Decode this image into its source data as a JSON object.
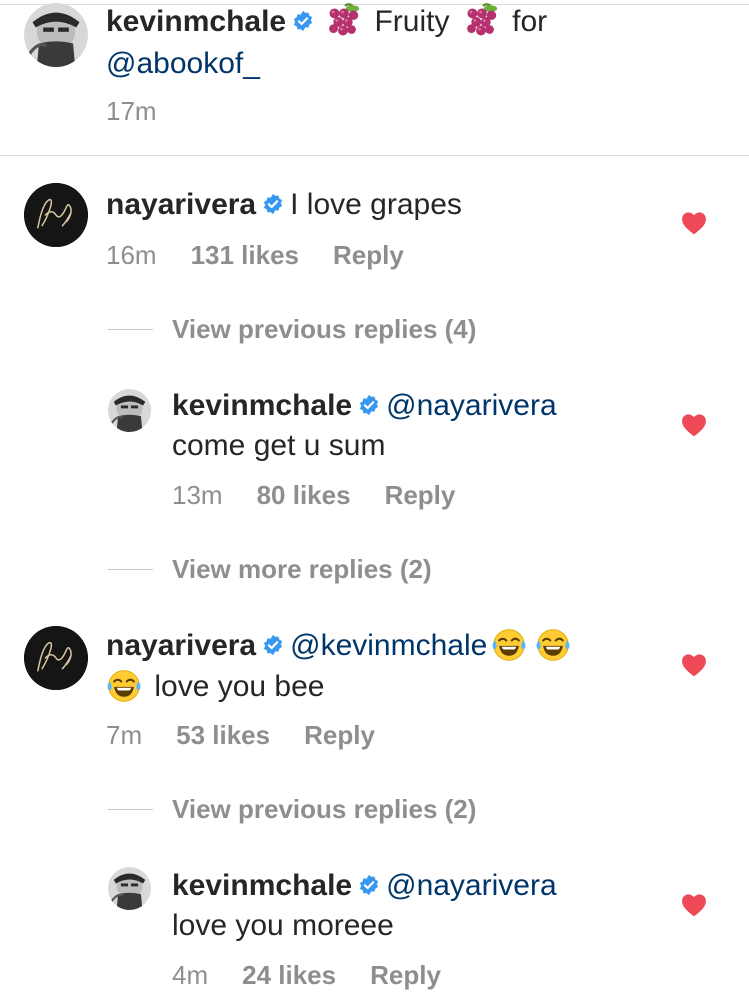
{
  "caption": {
    "username": "kevinmchale",
    "text_1": "Fruity",
    "text_2": "for",
    "mention": "@abookof_",
    "time": "17m",
    "emoji": "grapes-emoji"
  },
  "comments": [
    {
      "username": "nayarivera",
      "text": "I love grapes",
      "time": "16m",
      "likes": "131 likes",
      "reply": "Reply",
      "liked": true
    },
    {
      "view_replies": "View previous replies (4)"
    },
    {
      "username": "kevinmchale",
      "mention": "@nayarivera",
      "text": "come get u sum",
      "time": "13m",
      "likes": "80 likes",
      "reply": "Reply",
      "liked": true
    },
    {
      "view_replies": "View more replies (2)"
    },
    {
      "username": "nayarivera",
      "mention": "@kevinmchale",
      "text": "love you bee",
      "emoji": "face-with-tears-of-joy-emoji",
      "time": "7m",
      "likes": "53 likes",
      "reply": "Reply",
      "liked": true
    },
    {
      "view_replies": "View previous replies (2)"
    },
    {
      "username": "kevinmchale",
      "mention": "@nayarivera",
      "text": "love you moreee",
      "time": "4m",
      "likes": "24 likes",
      "reply": "Reply",
      "liked": true
    }
  ],
  "colors": {
    "text": "#262626",
    "meta": "#8e8e8e",
    "mention": "#003569",
    "verified": "#3897f0",
    "heart": "#ed4956"
  }
}
